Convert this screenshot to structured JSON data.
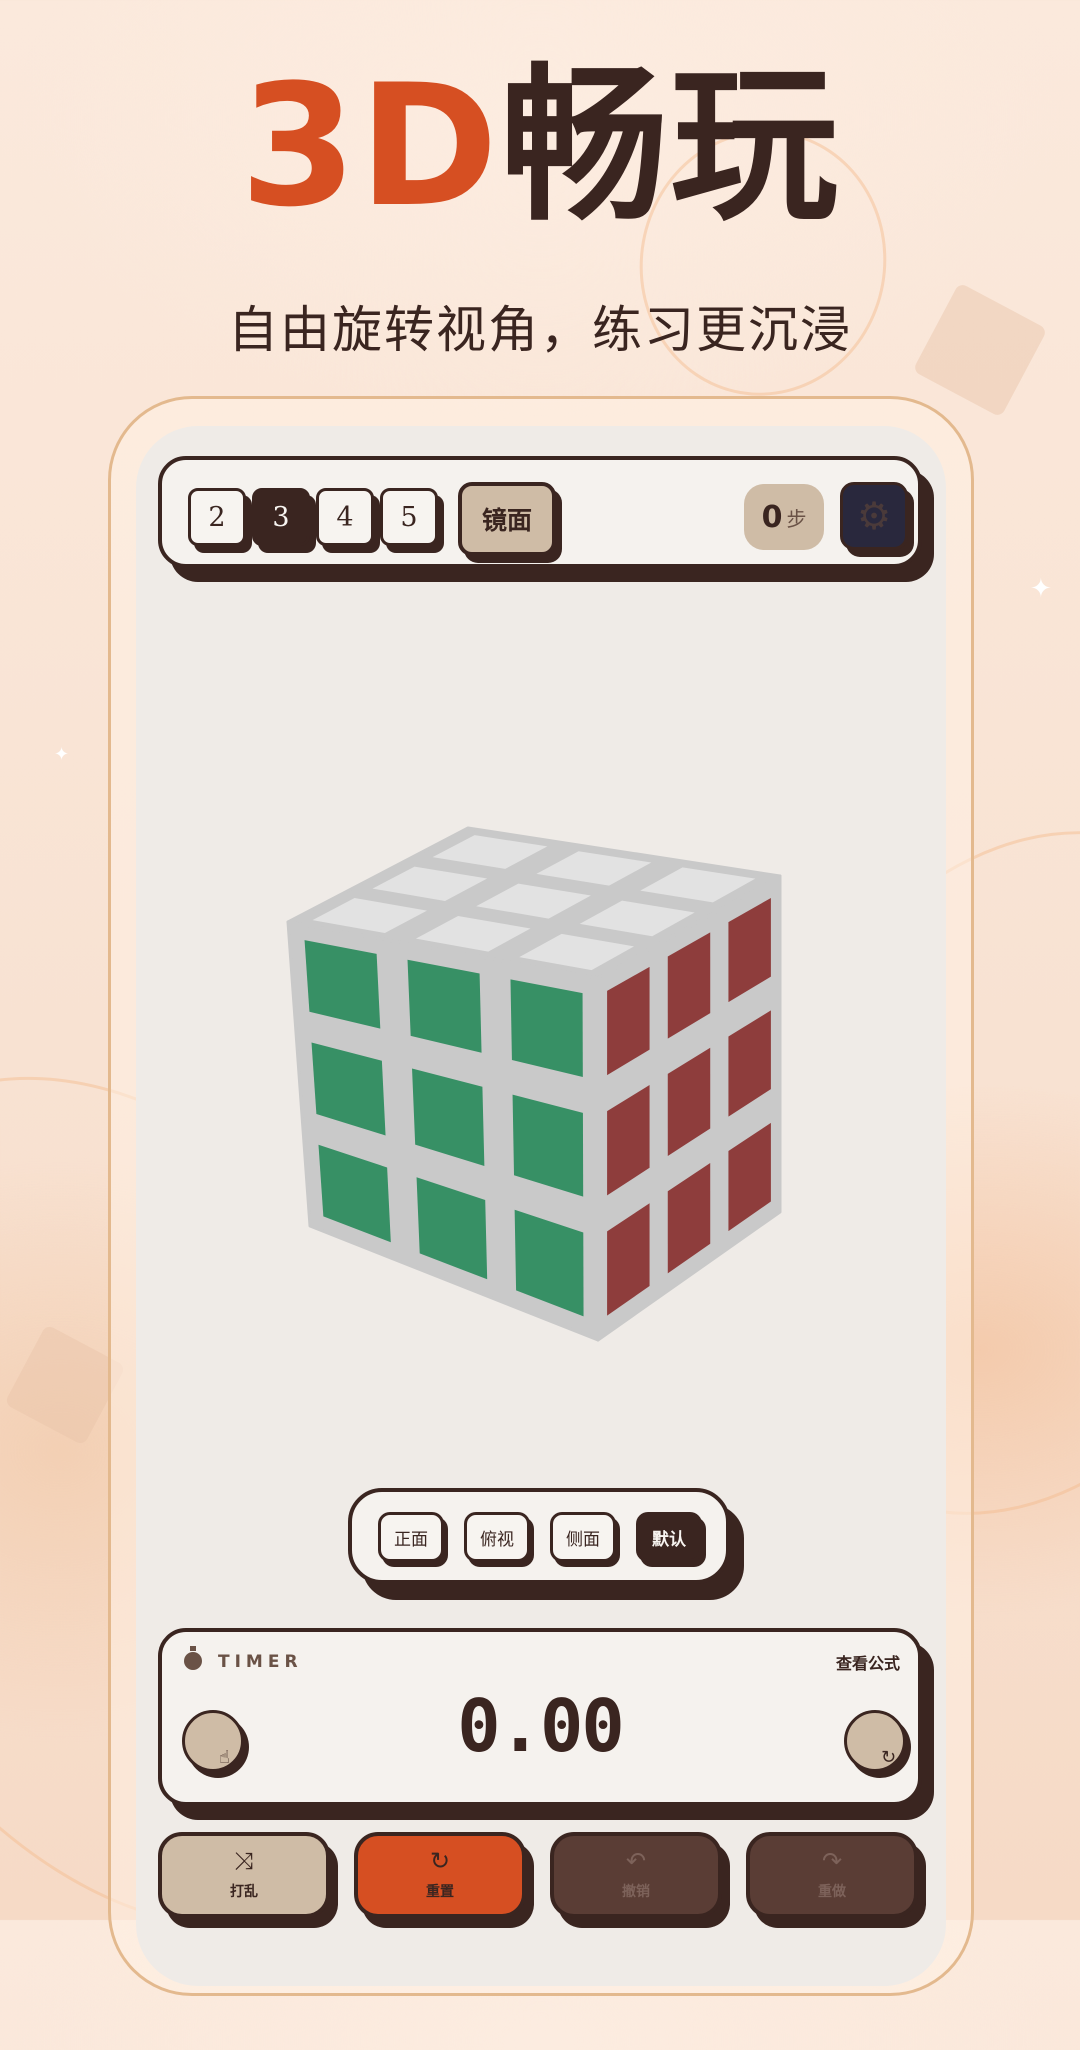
{
  "headline": {
    "accent": "3D",
    "main": "畅玩"
  },
  "subtitle": "自由旋转视角，练习更沉浸",
  "toolbar": {
    "cube_sizes": [
      "2",
      "3",
      "4",
      "5"
    ],
    "active_size": "3",
    "mirror_label": "镜面",
    "steps_count": "0",
    "steps_unit": "步",
    "settings_icon": "gear-icon"
  },
  "cube": {
    "faces": {
      "top": "#e2e2e2",
      "front": "#379065",
      "right": "#8e3d3c"
    },
    "frame_color": "#c9c9c9"
  },
  "views": {
    "items": [
      "正面",
      "俯视",
      "侧面",
      "默认"
    ],
    "active": "默认"
  },
  "timer": {
    "label": "TIMER",
    "formula_link": "查看公式",
    "value": "0.00"
  },
  "actions": {
    "scramble": "打乱",
    "reset": "重置",
    "undo": "撤销",
    "redo": "重做"
  },
  "colors": {
    "accent": "#d64f22",
    "ink": "#3a2520",
    "tan": "#cfbca6",
    "panel": "#f5f2ee"
  }
}
